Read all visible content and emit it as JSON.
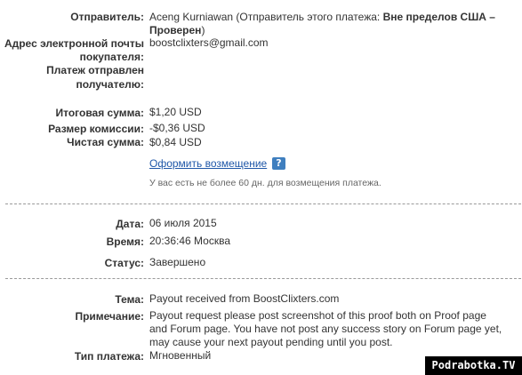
{
  "sender": {
    "label": "Отправитель:",
    "line1_prefix": "Aceng Kurniawan (Отправитель этого платежа: ",
    "line1_bold": "Вне пределов США –",
    "line2_bold": "Проверен",
    "line2_suffix": ")"
  },
  "buyer_email": {
    "label_line1": "Адрес электронной почты",
    "label_line2": "покупателя:",
    "value": "boostclixters@gmail.com"
  },
  "sent_to": {
    "label_line1": "Платеж отправлен",
    "label_line2": "получателю:"
  },
  "amounts": {
    "total_label": "Итоговая сумма:",
    "total_value": "$1,20 USD",
    "fee_label": "Размер комиссии:",
    "fee_value": "-$0,36 USD",
    "net_label": "Чистая сумма:",
    "net_value": "$0,84 USD"
  },
  "refund": {
    "link_text": "Оформить возмещение",
    "help_glyph": "?",
    "note": "У вас есть не более 60 дн. для возмещения платежа."
  },
  "details": {
    "date_label": "Дата:",
    "date_value": "06 июля 2015",
    "time_label": "Время:",
    "time_value": "20:36:46 Москва",
    "status_label": "Статус:",
    "status_value": "Завершено"
  },
  "message": {
    "subject_label": "Тема:",
    "subject_value": "Payout received from BoostClixters.com",
    "note_label": "Примечание:",
    "note_line1": "Payout request please post screenshot of this proof both on Proof page",
    "note_line2": "and Forum page. You have not post any success story on Forum page yet,",
    "note_line3": "may cause your next payout pending until you post.",
    "type_label": "Тип платежа:",
    "type_value": "Мгновенный"
  },
  "watermark": "Podrabotka.TV"
}
